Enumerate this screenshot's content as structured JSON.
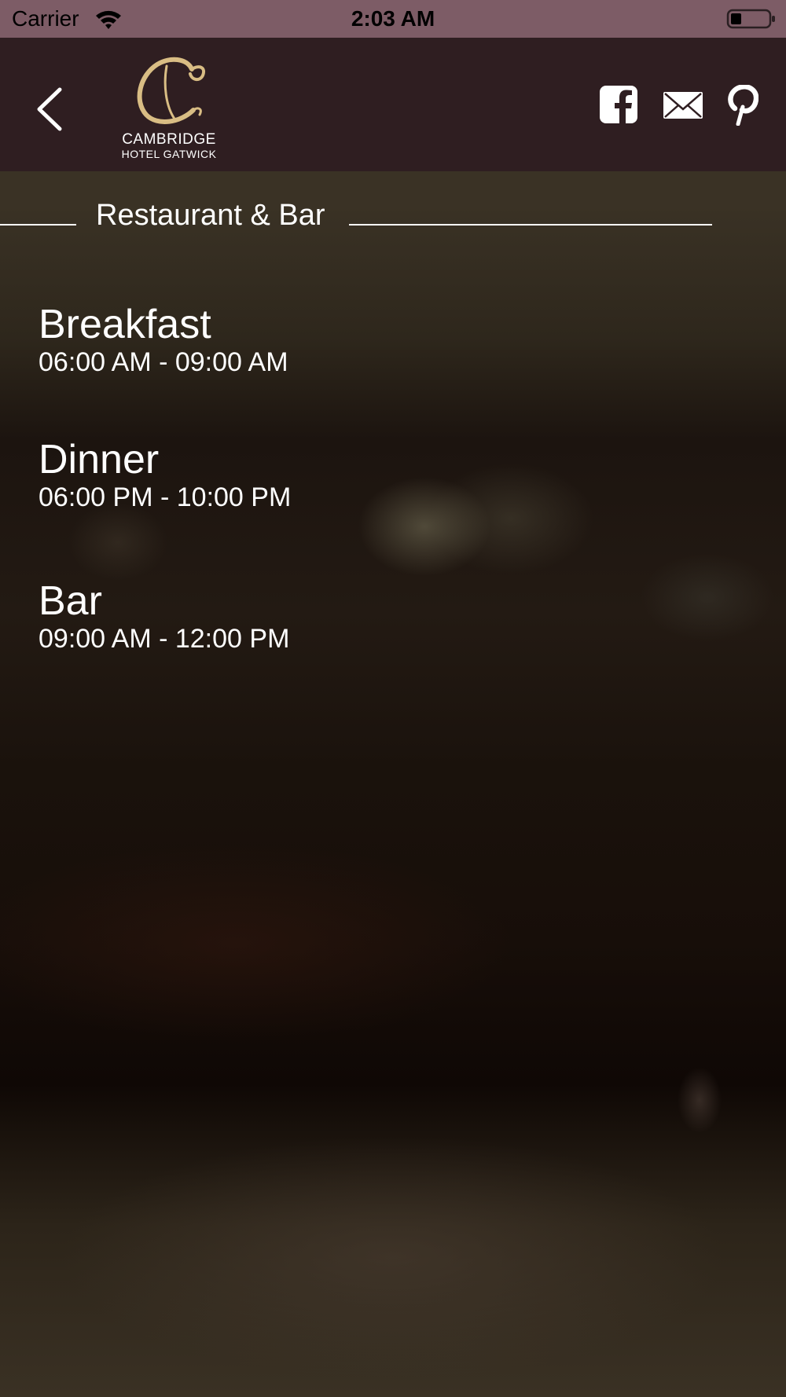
{
  "status_bar": {
    "carrier": "Carrier",
    "time": "2:03 AM",
    "wifi_icon": "wifi-icon",
    "battery_icon": "battery-icon",
    "battery_level": 0.25
  },
  "header": {
    "back_icon": "chevron-left-icon",
    "logo": {
      "line1": "CAMBRIDGE",
      "line2": "HOTEL GATWICK"
    },
    "social": [
      {
        "icon": "facebook-icon"
      },
      {
        "icon": "mail-icon"
      },
      {
        "icon": "pinterest-icon"
      }
    ]
  },
  "section": {
    "title": "Restaurant & Bar"
  },
  "hours": [
    {
      "name": "Breakfast",
      "time": "06:00 AM - 09:00 AM"
    },
    {
      "name": "Dinner",
      "time": "06:00 PM - 10:00 PM"
    },
    {
      "name": "Bar",
      "time": "09:00 AM - 12:00 PM"
    }
  ],
  "colors": {
    "status_bar_bg": "#7d5c66",
    "nav_bar_bg": "#2f1e21",
    "logo_gold": "#d9bd84",
    "text": "#ffffff"
  }
}
